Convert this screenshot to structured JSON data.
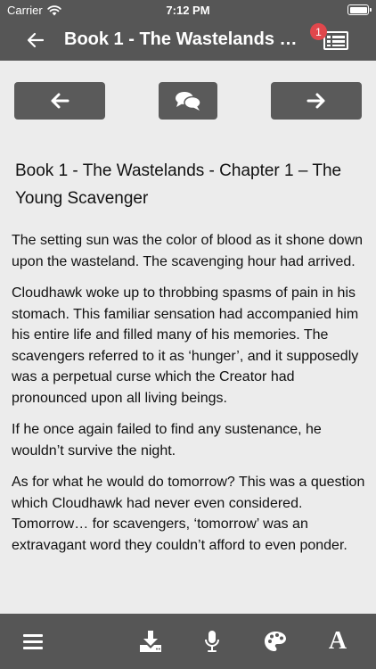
{
  "status_bar": {
    "carrier": "Carrier",
    "time": "7:12 PM"
  },
  "nav": {
    "title": "Book 1 - The Wastelands - Chapter 1 – The Young Scavenger",
    "notification_count": "1"
  },
  "chapter": {
    "title": "Book 1 - The Wastelands - Chapter 1 – The Young Scavenger",
    "paragraphs": [
      "The setting sun was the color of blood as it shone down upon the wasteland. The scavenging hour had arrived.",
      "Cloudhawk woke up to throbbing spasms of pain in his stomach. This familiar sensation had accompanied him his entire life and filled many of his memories. The scavengers referred to it as ‘hunger’, and it supposedly was a perpetual curse which the Creator had pronounced upon all living beings.",
      "If he once again failed to find any sustenance, he wouldn’t survive the night.",
      "As for what he would do tomorrow? This was a question which Cloudhawk had never even considered. Tomorrow… for scavengers, ‘tomorrow’ was an extravagant word they couldn’t afford to even ponder."
    ]
  },
  "toolbar": {
    "font_label": "A"
  },
  "icons": [
    "wifi-icon",
    "battery-icon",
    "back-arrow-icon",
    "notes-list-icon",
    "arrow-left-icon",
    "comments-icon",
    "arrow-right-icon",
    "menu-icon",
    "download-icon",
    "microphone-icon",
    "palette-icon",
    "font-icon"
  ],
  "colors": {
    "bar": "#565656",
    "button": "#5a5a5a",
    "background": "#ececec",
    "badge": "#e0474c"
  }
}
